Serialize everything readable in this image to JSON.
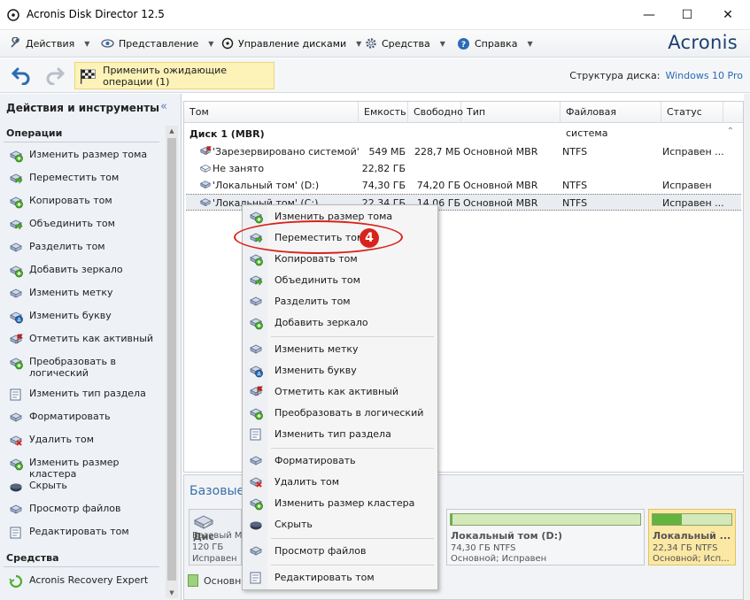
{
  "window": {
    "title": "Acronis Disk Director 12.5",
    "controls": {
      "minimize": "—",
      "maximize": "☐",
      "close": "✕"
    }
  },
  "menubar": {
    "items": [
      {
        "label": "Действия",
        "icon": "wrench-icon"
      },
      {
        "label": "Представление",
        "icon": "eye-icon"
      },
      {
        "label": "Управление дисками",
        "icon": "disk-manage-icon"
      },
      {
        "label": "Средства",
        "icon": "gear-icon"
      },
      {
        "label": "Справка",
        "icon": "help-icon"
      }
    ],
    "brand": "Acronis"
  },
  "toolbar": {
    "undo_icon": "undo-icon",
    "redo_icon": "redo-icon",
    "apply_label": "Применить ожидающие операции (1)",
    "disk_structure_label": "Структура диска:",
    "disk_structure_value": "Windows 10 Pro"
  },
  "leftpanel": {
    "title": "Действия и инструменты",
    "collapse": "«",
    "operations_title": "Операции",
    "operations": [
      {
        "label": "Изменить размер тома",
        "icon": "resize-volume-icon"
      },
      {
        "label": "Переместить том",
        "icon": "move-volume-icon"
      },
      {
        "label": "Копировать том",
        "icon": "copy-volume-icon"
      },
      {
        "label": "Объединить том",
        "icon": "merge-volume-icon"
      },
      {
        "label": "Разделить том",
        "icon": "split-volume-icon"
      },
      {
        "label": "Добавить зеркало",
        "icon": "add-mirror-icon"
      },
      {
        "label": "Изменить метку",
        "icon": "change-label-icon"
      },
      {
        "label": "Изменить букву",
        "icon": "change-letter-icon"
      },
      {
        "label": "Отметить как активный",
        "icon": "mark-active-icon"
      },
      {
        "label": "Преобразовать в логический",
        "icon": "convert-logical-icon"
      },
      {
        "label": "Изменить тип раздела",
        "icon": "partition-type-icon"
      },
      {
        "label": "Форматировать",
        "icon": "format-icon"
      },
      {
        "label": "Удалить том",
        "icon": "delete-volume-icon"
      },
      {
        "label": "Изменить размер кластера",
        "icon": "cluster-size-icon"
      },
      {
        "label": "Скрыть",
        "icon": "hide-icon"
      },
      {
        "label": "Просмотр файлов",
        "icon": "browse-files-icon"
      },
      {
        "label": "Редактировать том",
        "icon": "edit-volume-icon"
      }
    ],
    "tools_title": "Средства",
    "tools": [
      {
        "label": "Acronis Recovery Expert",
        "icon": "recovery-expert-icon"
      }
    ]
  },
  "table": {
    "columns": [
      "Том",
      "Емкость",
      "Свободно",
      "Тип",
      "Файловая система",
      "Статус"
    ],
    "disk_label": "Диск 1 (MBR)",
    "collapse": "≈",
    "rows": [
      {
        "name": "'Зарезервировано системой'",
        "capacity": "549 МБ",
        "free": "228,7 МБ",
        "type": "Основной MBR",
        "fs": "NTFS",
        "status": "Исправен ...",
        "selected": false
      },
      {
        "name": "Не занято",
        "capacity": "22,82 ГБ",
        "free": "",
        "type": "",
        "fs": "",
        "status": "",
        "selected": false
      },
      {
        "name": "'Локальный том' (D:)",
        "capacity": "74,30 ГБ",
        "free": "74,20 ГБ",
        "type": "Основной MBR",
        "fs": "NTFS",
        "status": "Исправен",
        "selected": false
      },
      {
        "name": "'Локальный том' (C:)",
        "capacity": "22,34 ГБ",
        "free": "14,06 ГБ",
        "type": "Основной MBR",
        "fs": "NTFS",
        "status": "Исправен ...",
        "selected": true
      }
    ]
  },
  "diskmap": {
    "title": "Базовые д",
    "disk": {
      "name": "Дис",
      "sub1": "Базовый MB",
      "sub2": "120 ГБ",
      "sub3": "Исправен"
    },
    "volumes": [
      {
        "name": "Локальный том (D:)",
        "sub1": "74,30 ГБ NTFS",
        "sub2": "Основной; Исправен",
        "fill": 0.01,
        "selected": false
      },
      {
        "name": "Локальный ...",
        "sub1": "22,34 ГБ NTFS",
        "sub2": "Основной; Исп...",
        "fill": 0.37,
        "selected": true
      }
    ],
    "legend": "Основно"
  },
  "context_menu": {
    "items": [
      {
        "label": "Изменить размер тома",
        "icon": "resize-volume-icon"
      },
      {
        "label": "Переместить том",
        "icon": "move-volume-icon"
      },
      {
        "label": "Копировать том",
        "icon": "copy-volume-icon"
      },
      {
        "label": "Объединить том",
        "icon": "merge-volume-icon"
      },
      {
        "label": "Разделить том",
        "icon": "split-volume-icon"
      },
      {
        "label": "Добавить зеркало",
        "icon": "add-mirror-icon"
      },
      {
        "label": "Изменить метку",
        "icon": "change-label-icon"
      },
      {
        "label": "Изменить букву",
        "icon": "change-letter-icon"
      },
      {
        "label": "Отметить как активный",
        "icon": "mark-active-icon"
      },
      {
        "label": "Преобразовать в логический",
        "icon": "convert-logical-icon"
      },
      {
        "label": "Изменить тип раздела",
        "icon": "partition-type-icon"
      },
      {
        "label": "Форматировать",
        "icon": "format-icon"
      },
      {
        "label": "Удалить том",
        "icon": "delete-volume-icon"
      },
      {
        "label": "Изменить размер кластера",
        "icon": "cluster-size-icon"
      },
      {
        "label": "Скрыть",
        "icon": "hide-icon"
      },
      {
        "label": "Просмотр файлов",
        "icon": "browse-files-icon"
      },
      {
        "label": "Редактировать том",
        "icon": "edit-volume-icon"
      }
    ]
  },
  "annotation": {
    "number": "4",
    "color": "#d8231c"
  },
  "colors": {
    "accent": "#2a6bb5",
    "brand": "#1d3f72",
    "highlight": "#fdf3b8",
    "volume_fill": "#64b33f"
  }
}
